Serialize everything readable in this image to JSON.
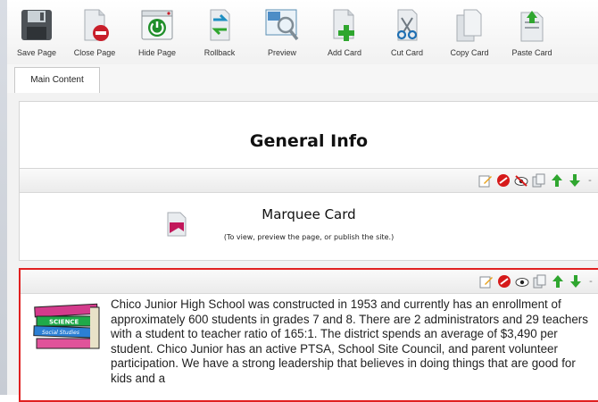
{
  "toolbar": {
    "buttons": [
      {
        "label": "Save Page",
        "icon": "floppy-disk-icon"
      },
      {
        "label": "Close Page",
        "icon": "close-page-icon"
      },
      {
        "label": "Hide Page",
        "icon": "hide-page-icon"
      },
      {
        "label": "Rollback",
        "icon": "rollback-icon"
      },
      {
        "label": "Preview",
        "icon": "preview-icon"
      },
      {
        "label": "Add Card",
        "icon": "add-card-icon"
      },
      {
        "label": "Cut Card",
        "icon": "cut-card-icon"
      },
      {
        "label": "Copy Card",
        "icon": "copy-card-icon"
      },
      {
        "label": "Paste Card",
        "icon": "paste-card-icon"
      }
    ]
  },
  "tabs": [
    {
      "label": "Main Content"
    }
  ],
  "cards": {
    "title": {
      "text": "General Info"
    },
    "marquee": {
      "title": "Marquee Card",
      "subtitle": "(To view, preview the page, or publish the site.)"
    },
    "text": {
      "image_lettering": [
        "SCIENCE",
        "Social Studies"
      ],
      "paragraph": "Chico Junior High School was constructed in 1953 and currently has an enrollment of approximately 600 students in grades 7 and 8. There are 2 administrators and 29 teachers with a student to teacher ratio of 165:1. The district spends an average of $3,490 per student. Chico Junior has an active PTSA, School Site Council, and parent volunteer participation. We have a strong leadership that believes in doing things that are good for kids and a"
    }
  },
  "card_tools": {
    "dash": "-",
    "icons": [
      "edit-icon",
      "delete-icon",
      "visibility-icon",
      "copy-icon",
      "move-up-icon",
      "move-down-icon"
    ]
  },
  "colors": {
    "selected_card_border": "#e02020",
    "arrow_green": "#2fa62f",
    "delete_red": "#d61a1a"
  }
}
